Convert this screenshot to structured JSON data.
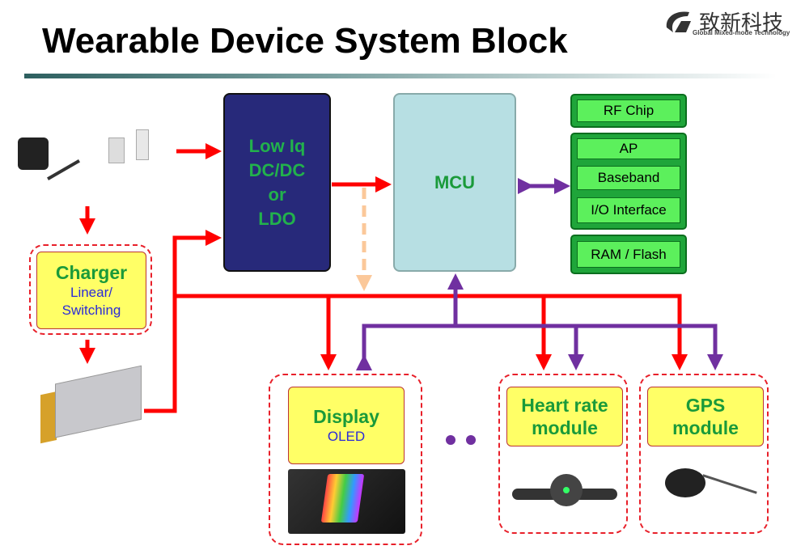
{
  "title": "Wearable Device System Block",
  "logo": {
    "name_cn": "致新科技",
    "tagline": "Global Mixed-mode Technology"
  },
  "power": {
    "line1": "Low Iq",
    "line2": "DC/DC",
    "line3": "or",
    "line4": "LDO"
  },
  "mcu": "MCU",
  "peripherals": {
    "rf": "RF Chip",
    "ap": "AP",
    "baseband": "Baseband",
    "io": "I/O Interface",
    "mem": "RAM / Flash"
  },
  "charger": {
    "title": "Charger",
    "line1": "Linear/",
    "line2": "Switching"
  },
  "display": {
    "title": "Display",
    "sub": "OLED"
  },
  "heart": {
    "line1": "Heart rate",
    "line2": "module"
  },
  "gps": {
    "line1": "GPS",
    "line2": "module"
  },
  "colors": {
    "power_line": "#ff0000",
    "bus_line": "#7030a0",
    "ldo": "#27297a",
    "mcu": "#b7dfe3",
    "highlight": "#ffff66",
    "green": "#1fa53a"
  },
  "images": [
    "ac-adapter",
    "usb-cable",
    "li-po-battery",
    "flexible-oled-display",
    "heart-rate-strap",
    "gps-antenna"
  ]
}
